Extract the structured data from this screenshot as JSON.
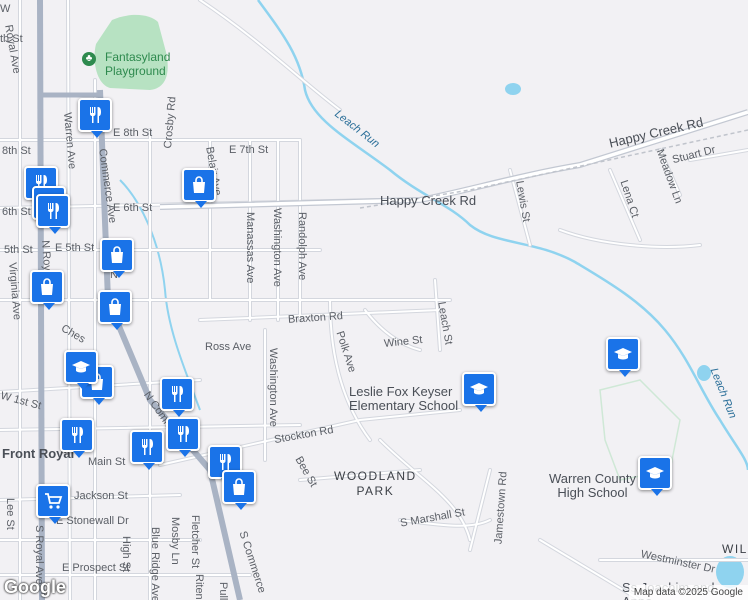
{
  "map": {
    "roads": {
      "north_royal_ave": "N Royal Ave",
      "royal_ave": "Royal Ave",
      "warren_ave": "Warren Ave",
      "commerce_ave": "Commerce Ave",
      "n_commerce": "N Comme",
      "s_commerce": "S Commerce",
      "crosby_rd": "Crosby Rd",
      "belair_ave": "Belair Ave",
      "e_8th_st": "E 8th St",
      "w_8th_st": "8th St",
      "e_7th_st": "E 7th St",
      "e_6th_st": "E 6th St",
      "w_6th_st": "6th St",
      "e_5th_st": "E 5th St",
      "w_5th_st": "5th St",
      "virginia_ave": "Virginia Ave",
      "manassas_ave": "Manassas Ave",
      "washington_ave_n": "Washington Ave",
      "randolph_ave": "Randolph Ave",
      "braxton_rd": "Braxton Rd",
      "ross_ave": "Ross Ave",
      "washington_ave_s": "Washington Ave",
      "polk_ave": "Polk Ave",
      "wine_st": "Wine St",
      "leach_st": "Leach St",
      "stockton_rd": "Stockton Rd",
      "bee_st": "Bee St",
      "happy_creek_rd_w": "Happy Creek Rd",
      "happy_creek_rd_e": "Happy Creek Rd",
      "lewis_st": "Lewis St",
      "lena_ct": "Lena Ct",
      "meadow_ln": "Meadow Ln",
      "stuart_dr": "Stuart Dr",
      "w_1st_st": "W 1st St",
      "chester": "Ches",
      "jackson_st": "Jackson St",
      "e_stonewall_dr": "E Stonewall Dr",
      "lee_st": "Lee St",
      "s_royal_ave": "S Royal Ave",
      "high_st": "High St",
      "blue_ridge_ave": "Blue Ridge Ave",
      "mosby_ln": "Mosby Ln",
      "fletcher_st": "Fletcher St",
      "e_prospect_st": "E Prospect St",
      "s_marshall_st": "S Marshall St",
      "jamestown_rd": "Jamestown Rd",
      "westminster_dr": "Westminster Dr",
      "main_st": "Main St",
      "riten": "Riten",
      "pull": "Pull",
      "n_fragment": "N",
      "th_st_top": "th St",
      "w_st_top": "W"
    },
    "places": {
      "fantasyland": "Fantasyland\nPlayground",
      "leach_run_n": "Leach Run",
      "leach_run_e": "Leach Run",
      "leslie_fox": "Leslie Fox Keyser\nElementary School",
      "woodland_park": "WOODLAND\nPARK",
      "warren_county_hs": "Warren County\nHigh School",
      "front_royal": "Front Royal",
      "ss_joachim": "Ss Joachim and\nAnne",
      "wil": "WIL"
    },
    "attribution": "Map data ©2025 Google",
    "logo": "Google",
    "colors": {
      "background": "#f2f1f4",
      "road": "#ffffff",
      "road_casing": "#c9ccd4",
      "highway": "#a9b3c4",
      "water": "#8fd3ef",
      "park": "#b7e2c2",
      "marker": "#1a73e8"
    },
    "markers": [
      {
        "type": "restaurant",
        "icon": "fork-knife-icon"
      },
      {
        "type": "restaurant",
        "icon": "fork-knife-icon"
      },
      {
        "type": "restaurant",
        "icon": "fork-knife-icon"
      },
      {
        "type": "restaurant",
        "icon": "fork-knife-icon"
      },
      {
        "type": "store",
        "icon": "shopping-bag-icon"
      },
      {
        "type": "store",
        "icon": "shopping-bag-icon"
      },
      {
        "type": "store",
        "icon": "shopping-bag-icon"
      },
      {
        "type": "store",
        "icon": "shopping-bag-icon"
      },
      {
        "type": "restaurant",
        "icon": "fork-knife-icon"
      },
      {
        "type": "school",
        "icon": "graduation-cap-icon"
      },
      {
        "type": "school",
        "icon": "graduation-cap-icon"
      },
      {
        "type": "school",
        "icon": "graduation-cap-icon"
      },
      {
        "type": "restaurant",
        "icon": "fork-knife-icon"
      },
      {
        "type": "restaurant",
        "icon": "fork-knife-icon"
      },
      {
        "type": "store",
        "icon": "shopping-bag-icon"
      },
      {
        "type": "grocery",
        "icon": "shopping-cart-icon"
      },
      {
        "type": "store",
        "icon": "shopping-bag-icon"
      },
      {
        "type": "restaurant",
        "icon": "fork-knife-icon"
      },
      {
        "type": "restaurant",
        "icon": "fork-knife-icon"
      },
      {
        "type": "school",
        "icon": "graduation-cap-icon"
      }
    ]
  }
}
